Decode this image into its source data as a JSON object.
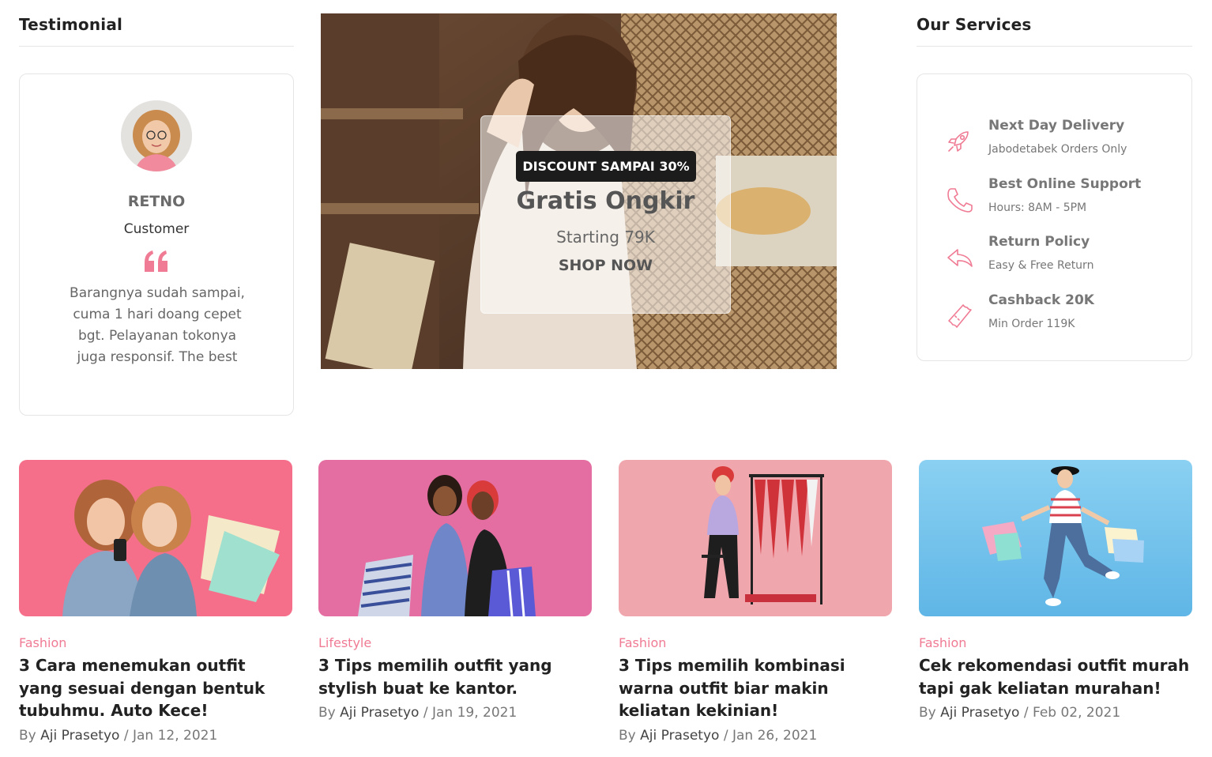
{
  "testimonial": {
    "heading": "Testimonial",
    "name": "RETNO",
    "role": "Customer",
    "quote": "Barangnya sudah sampai, cuma 1 hari doang cepet bgt. Pelayanan tokonya juga responsif. The best"
  },
  "banner": {
    "badge": "DISCOUNT SAMPAI 30%",
    "title": "Gratis Ongkir",
    "subtitle": "Starting 79K",
    "cta": "SHOP NOW"
  },
  "services": {
    "heading": "Our Services",
    "items": [
      {
        "title": "Next Day Delivery",
        "subtitle": "Jabodetabek Orders Only",
        "icon": "rocket-icon"
      },
      {
        "title": "Best Online Support",
        "subtitle": "Hours: 8AM - 5PM",
        "icon": "phone-icon"
      },
      {
        "title": "Return Policy",
        "subtitle": "Easy & Free Return",
        "icon": "return-arrow-icon"
      },
      {
        "title": "Cashback 20K",
        "subtitle": "Min Order 119K",
        "icon": "ticket-icon"
      }
    ]
  },
  "posts": [
    {
      "category": "Fashion",
      "title": "3 Cara menemukan outfit yang sesuai dengan bentuk tubuhmu. Auto Kece!",
      "by": "By",
      "author": "Aji Prasetyo",
      "sep": "/",
      "date": "Jan 12, 2021"
    },
    {
      "category": "Lifestyle",
      "title": "3 Tips memilih outfit yang stylish buat ke kantor.",
      "by": "By",
      "author": "Aji Prasetyo",
      "sep": "/",
      "date": "Jan 19, 2021"
    },
    {
      "category": "Fashion",
      "title": "3 Tips memilih kombinasi warna outfit biar makin keliatan kekinian!",
      "by": "By",
      "author": "Aji Prasetyo",
      "sep": "/",
      "date": "Jan 26, 2021"
    },
    {
      "category": "Fashion",
      "title": "Cek rekomendasi outfit murah tapi gak keliatan murahan!",
      "by": "By",
      "author": "Aji Prasetyo",
      "sep": "/",
      "date": "Feb 02, 2021"
    }
  ],
  "colors": {
    "accent": "#f07b94",
    "badge_bg": "#1c1c1c"
  }
}
